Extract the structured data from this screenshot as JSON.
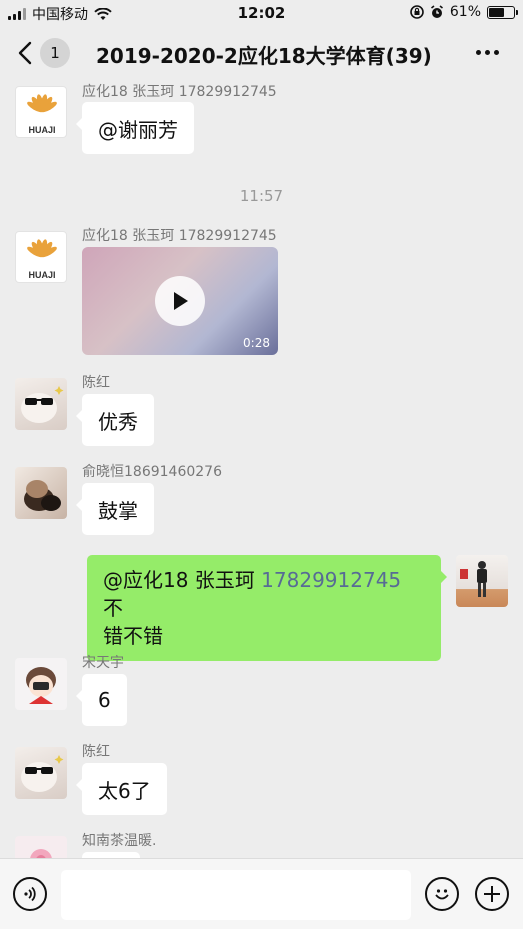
{
  "status_bar": {
    "carrier": "中国移动",
    "time": "12:02",
    "battery_percent": "61%",
    "battery_level": 0.61,
    "icons": [
      "signal-icon",
      "wifi-icon",
      "orientation-lock-icon",
      "alarm-icon",
      "battery-icon"
    ]
  },
  "nav": {
    "unread_count": "1",
    "title": "2019-2020-2应化18大学体育(39)"
  },
  "messages": [
    {
      "sender": "应化18 张玉珂 17829912745",
      "text": "@谢丽芳",
      "avatar_text": "HUAJI"
    },
    {
      "timestamp": "11:57"
    },
    {
      "sender": "应化18 张玉珂 17829912745",
      "video_duration": "0:28",
      "avatar_text": "HUAJI"
    },
    {
      "sender": "陈红",
      "text": "优秀"
    },
    {
      "sender": "俞晓恒18691460276",
      "text": "鼓掌"
    },
    {
      "mention": "@应化18 张玉珂 ",
      "phone": "17829912745",
      "suffix": " 不",
      "line2": "错不错"
    },
    {
      "sender": "宋天宇",
      "text": "6"
    },
    {
      "sender": "陈红",
      "text": "太6了"
    },
    {
      "sender": "知南茶温暖."
    }
  ],
  "input_bar": {
    "value": "",
    "icons": [
      "voice-icon",
      "emoji-icon",
      "plus-icon"
    ]
  },
  "colors": {
    "background": "#ededed",
    "outgoing_bubble": "#95ec69",
    "mention_link": "#576b95"
  }
}
